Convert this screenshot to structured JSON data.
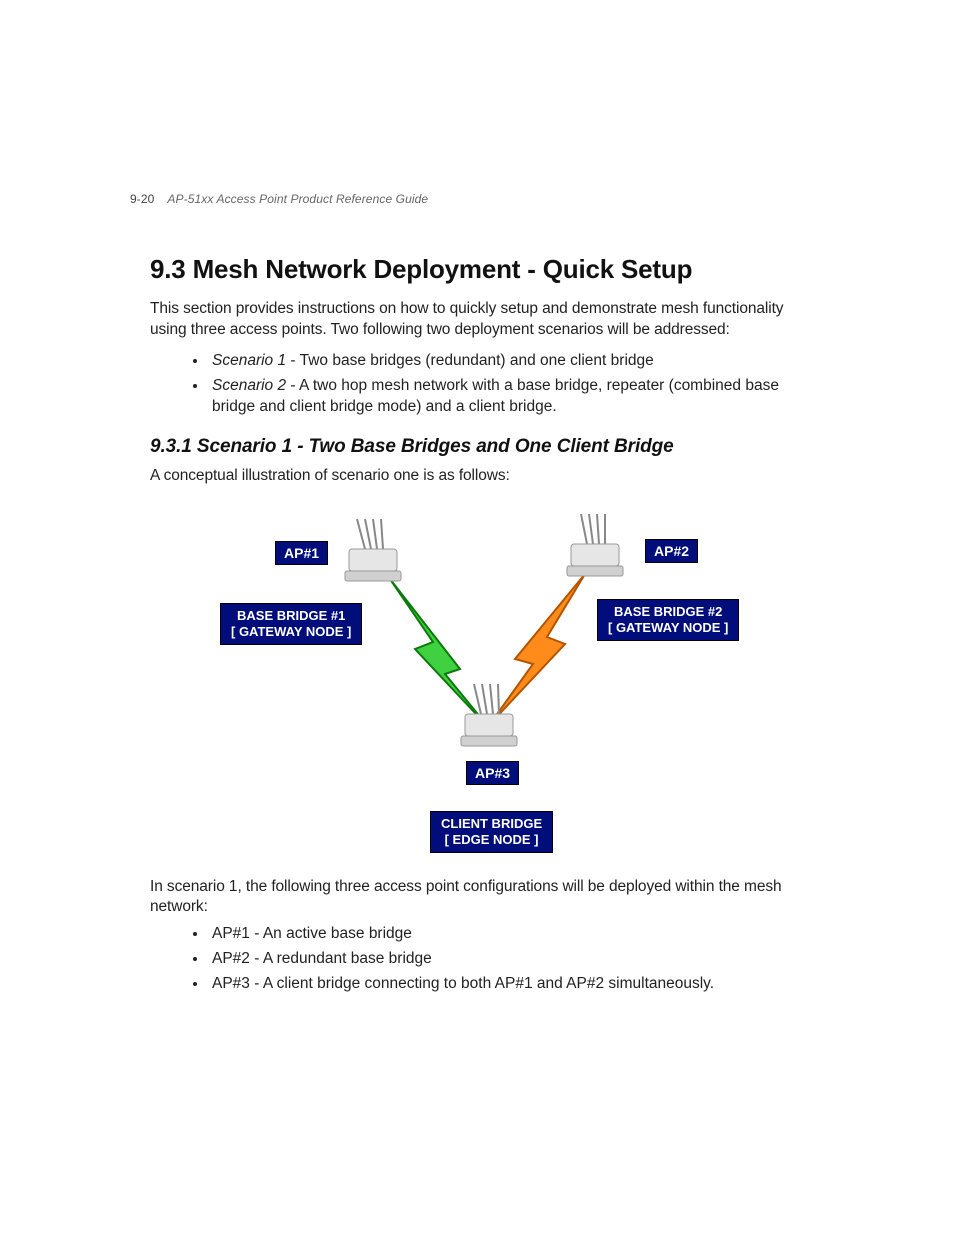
{
  "header": {
    "page_number": "9-20",
    "guide_title": "AP-51xx Access Point Product Reference Guide"
  },
  "section": {
    "heading": "9.3 Mesh Network Deployment - Quick Setup",
    "intro": "This section provides instructions on how to quickly setup and demonstrate mesh functionality using three access points. Two following two deployment scenarios will be addressed:",
    "scenarios": [
      {
        "label": "Scenario 1",
        "desc": " - Two base bridges (redundant) and one client bridge"
      },
      {
        "label": "Scenario 2",
        "desc": " - A two hop mesh network with a base bridge, repeater (combined base bridge and client bridge mode) and a client bridge."
      }
    ]
  },
  "subsection": {
    "heading": "9.3.1 Scenario 1 - Two Base Bridges and One Client Bridge",
    "caption": "A conceptual illustration of scenario one is as follows:",
    "post_fig": "In scenario 1, the following three access point configurations will be deployed within the mesh network:",
    "config_items": [
      "AP#1 - An active base bridge",
      "AP#2 - A redundant base bridge",
      "AP#3 - A client bridge connecting to both AP#1 and AP#2 simultaneously."
    ]
  },
  "figure": {
    "ap1": {
      "badge": "AP#1",
      "role_line1": "BASE BRIDGE #1",
      "role_line2": "[ GATEWAY NODE ]"
    },
    "ap2": {
      "badge": "AP#2",
      "role_line1": "BASE BRIDGE #2",
      "role_line2": "[ GATEWAY NODE ]"
    },
    "ap3": {
      "badge": "AP#3",
      "role_line1": "CLIENT BRIDGE",
      "role_line2": "[ EDGE NODE ]"
    }
  }
}
